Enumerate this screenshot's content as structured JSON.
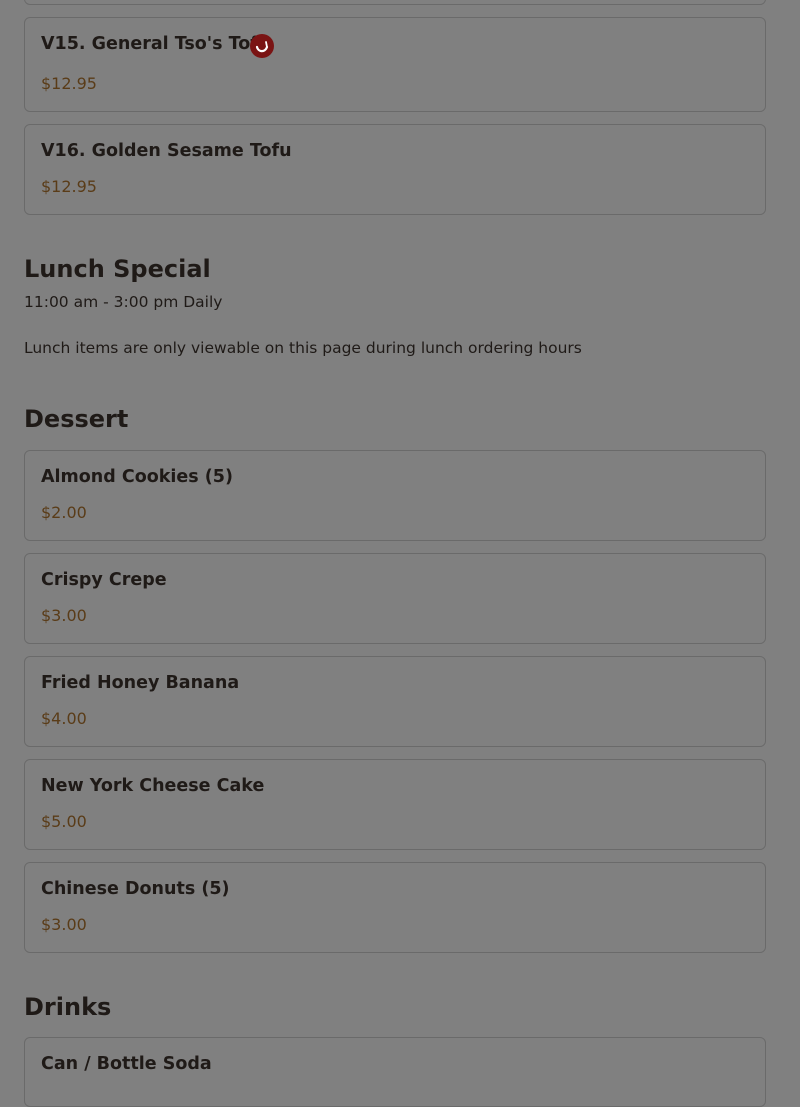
{
  "vegetarian": {
    "items": [
      {
        "name": "V15. General Tso's Tofu",
        "price": "$12.95",
        "icon": "spicy-pepper-icon"
      },
      {
        "name": "V16. Golden Sesame Tofu",
        "price": "$12.95"
      }
    ]
  },
  "lunch_special": {
    "title": "Lunch Special",
    "hours": "11:00 am - 3:00 pm Daily",
    "note": "Lunch items are only viewable on this page during lunch ordering hours"
  },
  "dessert": {
    "title": "Dessert",
    "items": [
      {
        "name": "Almond Cookies (5)",
        "price": "$2.00"
      },
      {
        "name": "Crispy Crepe",
        "price": "$3.00"
      },
      {
        "name": "Fried Honey Banana",
        "price": "$4.00"
      },
      {
        "name": "New York Cheese Cake",
        "price": "$5.00"
      },
      {
        "name": "Chinese Donuts (5)",
        "price": "$3.00"
      }
    ]
  },
  "drinks": {
    "title": "Drinks",
    "items": [
      {
        "name": "Can / Bottle Soda"
      }
    ]
  },
  "colors": {
    "overlay": "#808080",
    "price": "#5a3c18",
    "spicy_icon": "#7a1414"
  }
}
